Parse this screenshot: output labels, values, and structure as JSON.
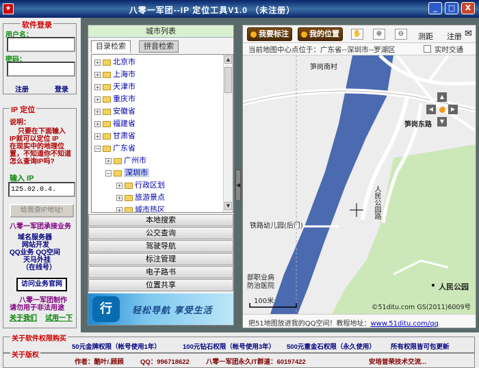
{
  "window": {
    "app_icon": "★",
    "title": "八零一军团--IP 定位工具V1.0        （未注册）",
    "min": "_",
    "max": "□",
    "close": "X"
  },
  "login": {
    "legend": "软件登录",
    "username_label": "用户名：",
    "username_value": "",
    "password_label": "密码：",
    "password_value": "",
    "register": "注册",
    "login": "登录"
  },
  "ip": {
    "legend": "IP 定位",
    "instructions": [
      "说明：",
      "只要在下面输入",
      "IP就可以定位 IP",
      "在现实中的地理位",
      "置，不知道你不知道",
      "怎么查询IP吗?"
    ],
    "input_label": "输入 IP",
    "input_value": "125.02.0.4.",
    "submit_button": "给我查IP地址!",
    "promo_title": "八零一军团承接业务",
    "services": [
      "域名服务器",
      "网站开发",
      "QQ业务  QQ空间",
      "天马外挂",
      "（在线号）"
    ],
    "visit_button": "访问业务官网",
    "footer_lines": [
      "八零一军团制作",
      "请勿用于非法用途"
    ],
    "about_link": "关于我们",
    "trial_link": "试用一下"
  },
  "city_panel": {
    "header": "城市列表",
    "tabs": [
      "目录检索",
      "拼音检索"
    ],
    "tree": [
      {
        "label": "北京市",
        "level": 0,
        "expanded": false
      },
      {
        "label": "上海市",
        "level": 0,
        "expanded": false
      },
      {
        "label": "天津市",
        "level": 0,
        "expanded": false
      },
      {
        "label": "重庆市",
        "level": 0,
        "expanded": false
      },
      {
        "label": "安徽省",
        "level": 0,
        "expanded": false
      },
      {
        "label": "福建省",
        "level": 0,
        "expanded": false
      },
      {
        "label": "甘肃省",
        "level": 0,
        "expanded": false
      },
      {
        "label": "广东省",
        "level": 0,
        "expanded": true
      },
      {
        "label": "广州市",
        "level": 1,
        "expanded": false
      },
      {
        "label": "深圳市",
        "level": 1,
        "expanded": true,
        "selected": true
      },
      {
        "label": "行政区划",
        "level": 2,
        "expanded": false
      },
      {
        "label": "旅游景点",
        "level": 2,
        "expanded": false
      },
      {
        "label": "城市热区",
        "level": 2,
        "expanded": false
      }
    ],
    "menu": [
      "本地搜索",
      "公交查询",
      "驾驶导航",
      "标注管理",
      "电子路书",
      "位置共享"
    ],
    "ad_logo": "行",
    "ad_slogan": "轻松导航  享受生活",
    "collapse": "◀"
  },
  "map": {
    "toolbar": {
      "mark_button": "我要标注",
      "location_button": "我的位置",
      "pan_icon": "✋",
      "zoomin_icon": "⊕",
      "zoomout_icon": "⊖",
      "measure_label": "测距",
      "mark_label": "注册",
      "mail_icon": "✉"
    },
    "status": "当前地图中心点位于：广东省--深圳市--罗湖区",
    "realtime_traffic": "实时交通",
    "labels": {
      "north_village": "笋岗南村",
      "dongmen": "笋岗东路",
      "renmin_road": "人民公园路",
      "kindergarten": "铁路幼儿园(后门)",
      "park": "人民公园",
      "hospital": "部职业病防治医院",
      "scale": "100米",
      "copyright": "©51ditu.com GS(2011)6009号"
    },
    "foot_text": "把51地图放进我的QQ空间！教程地址：",
    "foot_link": "www.51ditu.com/qq"
  },
  "bottom": {
    "legend1": "关于软件权限购买",
    "plans": [
      "50元金牌权限（帐号使用1年）",
      "100元钻石权限（帐号使用3年）",
      "500元重金石权限（永久使用）",
      "所有权限皆可包更新"
    ],
    "legend2": "关于版权",
    "credits": [
      "作者：酷叶/.顾顾",
      "QQ：996718622",
      "八零一军团永久IT群道：60197422",
      "安培普荣技术交流..."
    ]
  },
  "colors": {
    "legend": "#cc0000",
    "green_label": "#008000",
    "link": "#000080",
    "map_water": "#4b6ab0",
    "map_park": "#cce8b8"
  }
}
